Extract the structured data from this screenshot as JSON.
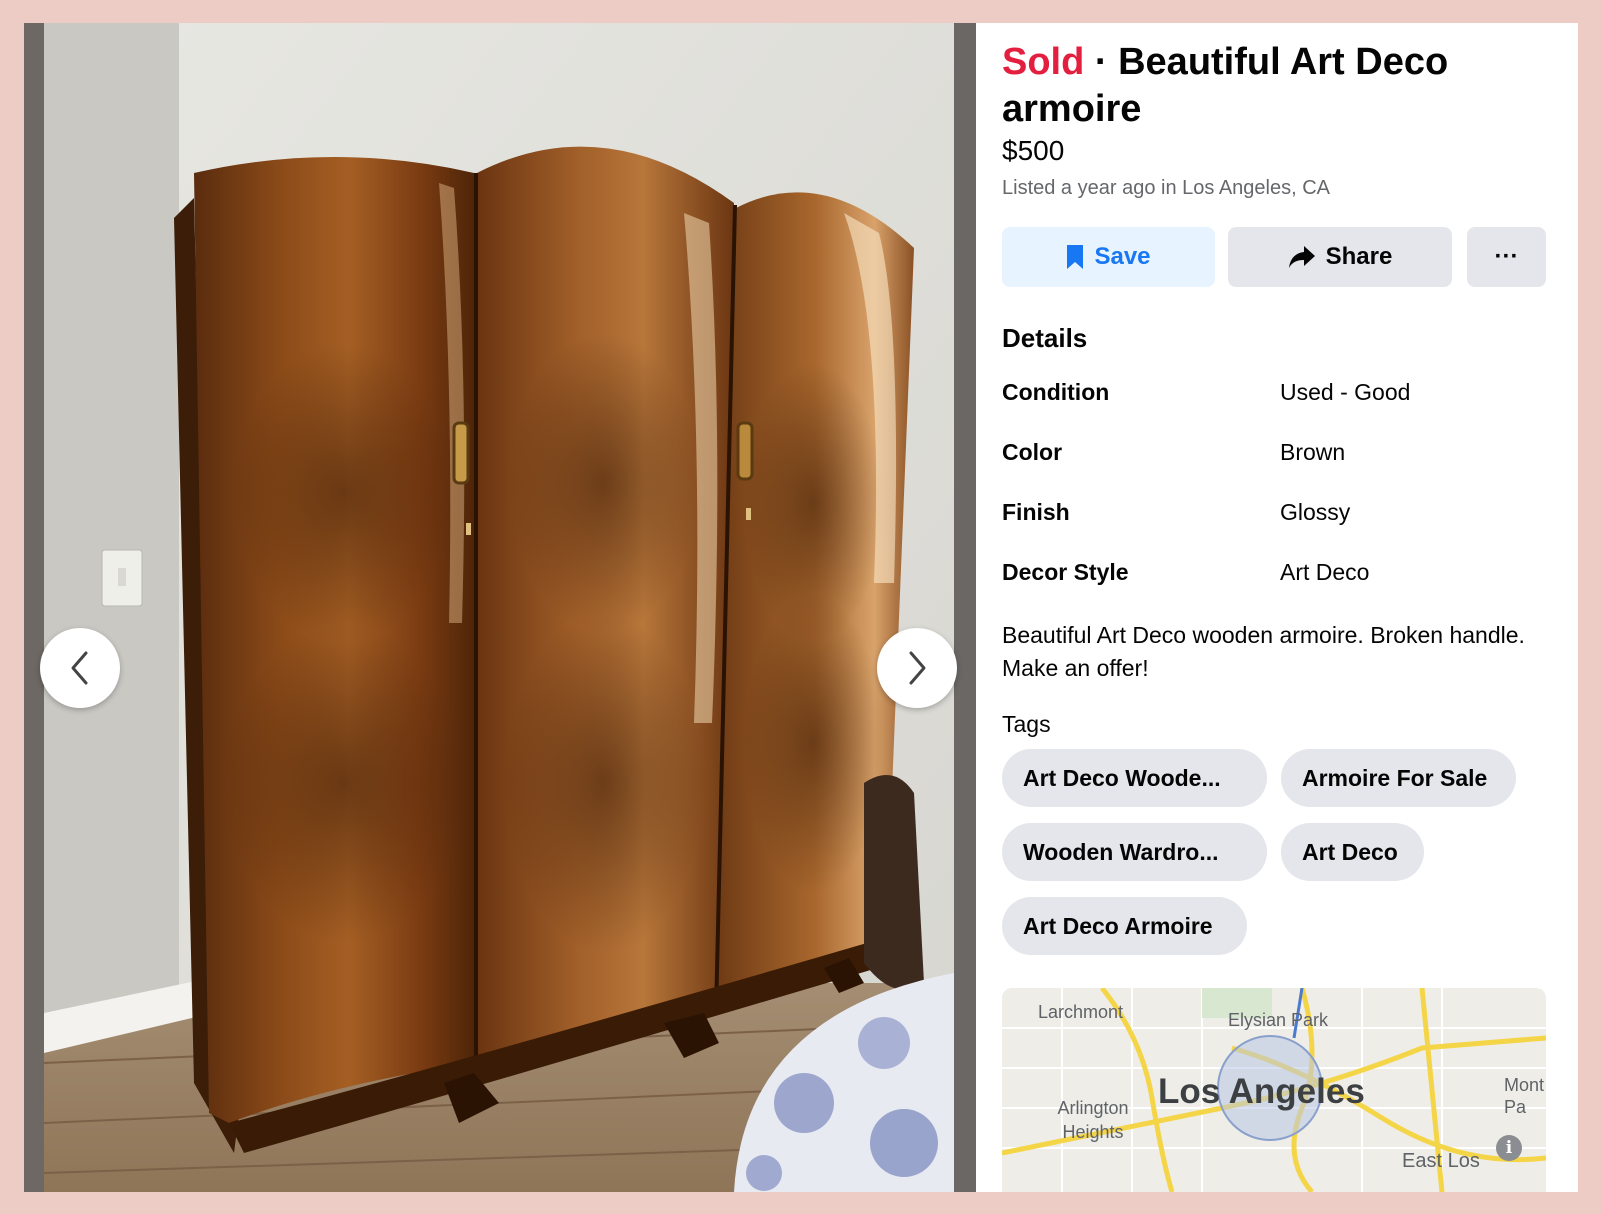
{
  "listing": {
    "status": "Sold",
    "separator": " · ",
    "title": "Beautiful Art Deco armoire",
    "price": "$500",
    "listed": "Listed a year ago in Los Angeles, CA"
  },
  "actions": {
    "save_label": "Save",
    "share_label": "Share",
    "more_label": "···",
    "save_icon": "bookmark-icon",
    "share_icon": "share-arrow-icon"
  },
  "details": {
    "heading": "Details",
    "rows": [
      {
        "label": "Condition",
        "value": "Used - Good"
      },
      {
        "label": "Color",
        "value": "Brown"
      },
      {
        "label": "Finish",
        "value": "Glossy"
      },
      {
        "label": "Decor Style",
        "value": "Art Deco"
      }
    ]
  },
  "description": "Beautiful Art Deco wooden armoire. Broken handle. Make an offer!",
  "tags": {
    "heading": "Tags",
    "items": [
      "Art Deco Woode...",
      "Armoire For Sale",
      "Wooden Wardro...",
      "Art Deco",
      "Art Deco Armoire"
    ]
  },
  "map": {
    "labels": [
      "Larchmont",
      "Elysian Park",
      "Arlington Heights",
      "Mont Pa",
      "East Los"
    ],
    "city": "Los Angeles",
    "info_icon": "i"
  },
  "photo": {
    "prev_icon": "chevron-left-icon",
    "next_icon": "chevron-right-icon"
  },
  "colors": {
    "background": "#ecccc4",
    "sold": "#e41e3f",
    "accent": "#1877f2",
    "button_gray": "#e4e6eb",
    "save_bg": "#e7f3ff",
    "secondary_text": "#65676b"
  }
}
